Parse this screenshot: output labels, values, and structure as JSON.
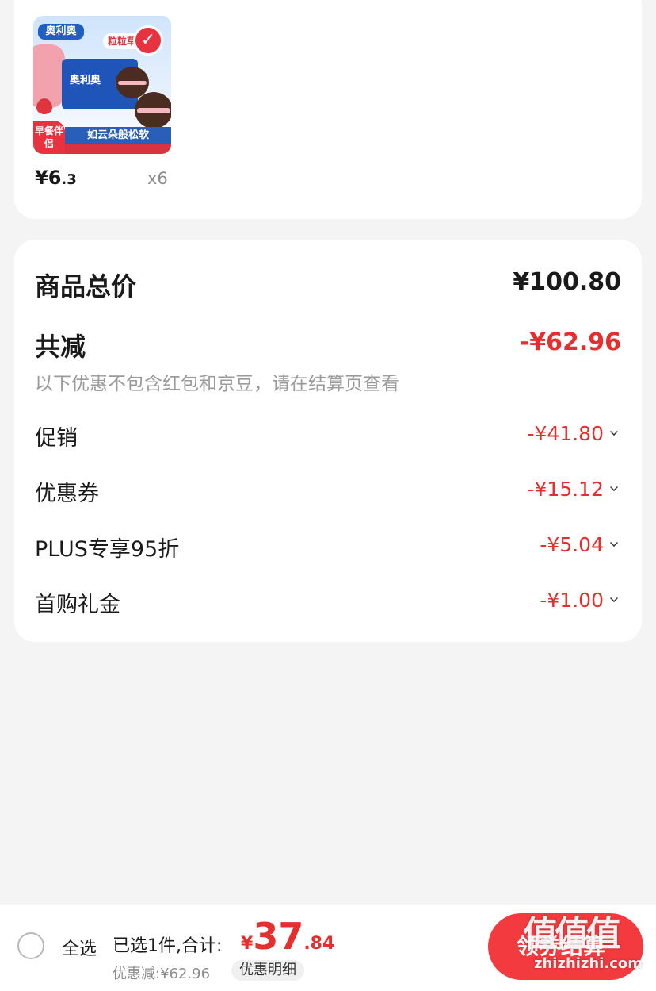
{
  "product": {
    "thumb_logo": "奥利奥",
    "thumb_box_title": "奥利奥",
    "thumb_tag": "粒粒草",
    "check_mark": "✓",
    "thumb_corner": "早餐伴侣",
    "thumb_banner": "如云朵般松软",
    "price_symbol": "¥",
    "price_int": "6",
    "price_dec": ".3",
    "quantity": "x6"
  },
  "summary": {
    "total_label": "商品总价",
    "total_amount": "¥100.80",
    "reduce_label": "共减",
    "reduce_amount": "-¥62.96",
    "note": "以下优惠不包含红包和京豆，请在结算页查看",
    "details": [
      {
        "label": "促销",
        "amount": "-¥41.80"
      },
      {
        "label": "优惠券",
        "amount": "-¥15.12"
      },
      {
        "label": "PLUS专享95折",
        "amount": "-¥5.04"
      },
      {
        "label": "首购礼金",
        "amount": "-¥1.00"
      }
    ]
  },
  "bottom_bar": {
    "select_all": "全选",
    "selected_info": "已选1件,合计:",
    "total_symbol": "¥",
    "total_int": "37",
    "total_dec": ".84",
    "discount_line": "优惠减:¥62.96",
    "discount_detail": "优惠明细",
    "checkout_label": "领券结算"
  },
  "watermark": {
    "big": "值值值",
    "small": "zhizhizhi.com"
  },
  "colors": {
    "accent_red": "#e62e2e",
    "button_red": "#f23a3f",
    "background": "#f4f4f4"
  }
}
